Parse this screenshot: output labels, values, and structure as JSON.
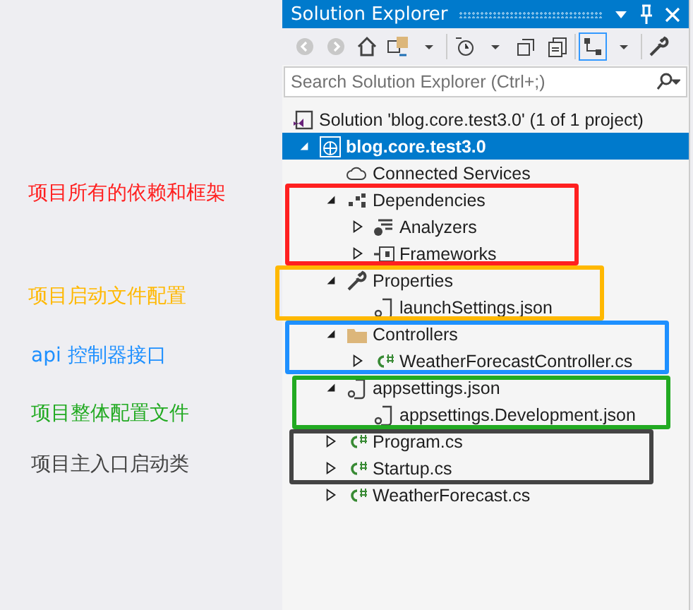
{
  "annotations": [
    {
      "label": "项目所有的依赖和框架",
      "color": "#ff2020"
    },
    {
      "label": "项目启动文件配置",
      "color": "#ffb800"
    },
    {
      "label": "api 控制器接口",
      "color": "#1e90ff"
    },
    {
      "label": "项目整体配置文件",
      "color": "#22aa22"
    },
    {
      "label": "项目主入口启动类",
      "color": "#444444"
    }
  ],
  "panel": {
    "title": "Solution Explorer",
    "search": {
      "placeholder": "Search Solution Explorer (Ctrl+;)"
    },
    "tree": [
      {
        "label": "Solution 'blog.core.test3.0' (1 of 1 project)",
        "kind": "solution",
        "selected": false
      },
      {
        "label": "blog.core.test3.0",
        "kind": "project",
        "selected": true,
        "expanded": true,
        "children": [
          {
            "label": "Connected Services",
            "kind": "connected",
            "selected": false
          },
          {
            "label": "Dependencies",
            "kind": "dependencies",
            "selected": false,
            "expanded": true,
            "children": [
              {
                "label": "Analyzers",
                "kind": "analyzers",
                "selected": false,
                "expanded": false
              },
              {
                "label": "Frameworks",
                "kind": "frameworks",
                "selected": false,
                "expanded": false
              }
            ]
          },
          {
            "label": "Properties",
            "kind": "properties",
            "selected": false,
            "expanded": true,
            "children": [
              {
                "label": "launchSettings.json",
                "kind": "json",
                "selected": false
              }
            ]
          },
          {
            "label": "Controllers",
            "kind": "folder",
            "selected": false,
            "expanded": true,
            "children": [
              {
                "label": "WeatherForecastController.cs",
                "kind": "csharp",
                "selected": false,
                "expanded": false
              }
            ]
          },
          {
            "label": "appsettings.json",
            "kind": "json",
            "selected": false,
            "expanded": true,
            "children": [
              {
                "label": "appsettings.Development.json",
                "kind": "json",
                "selected": false
              }
            ]
          },
          {
            "label": "Program.cs",
            "kind": "csharp",
            "selected": false,
            "expanded": false
          },
          {
            "label": "Startup.cs",
            "kind": "csharp",
            "selected": false,
            "expanded": false
          },
          {
            "label": "WeatherForecast.cs",
            "kind": "csharp",
            "selected": false,
            "expanded": false
          }
        ]
      }
    ]
  }
}
